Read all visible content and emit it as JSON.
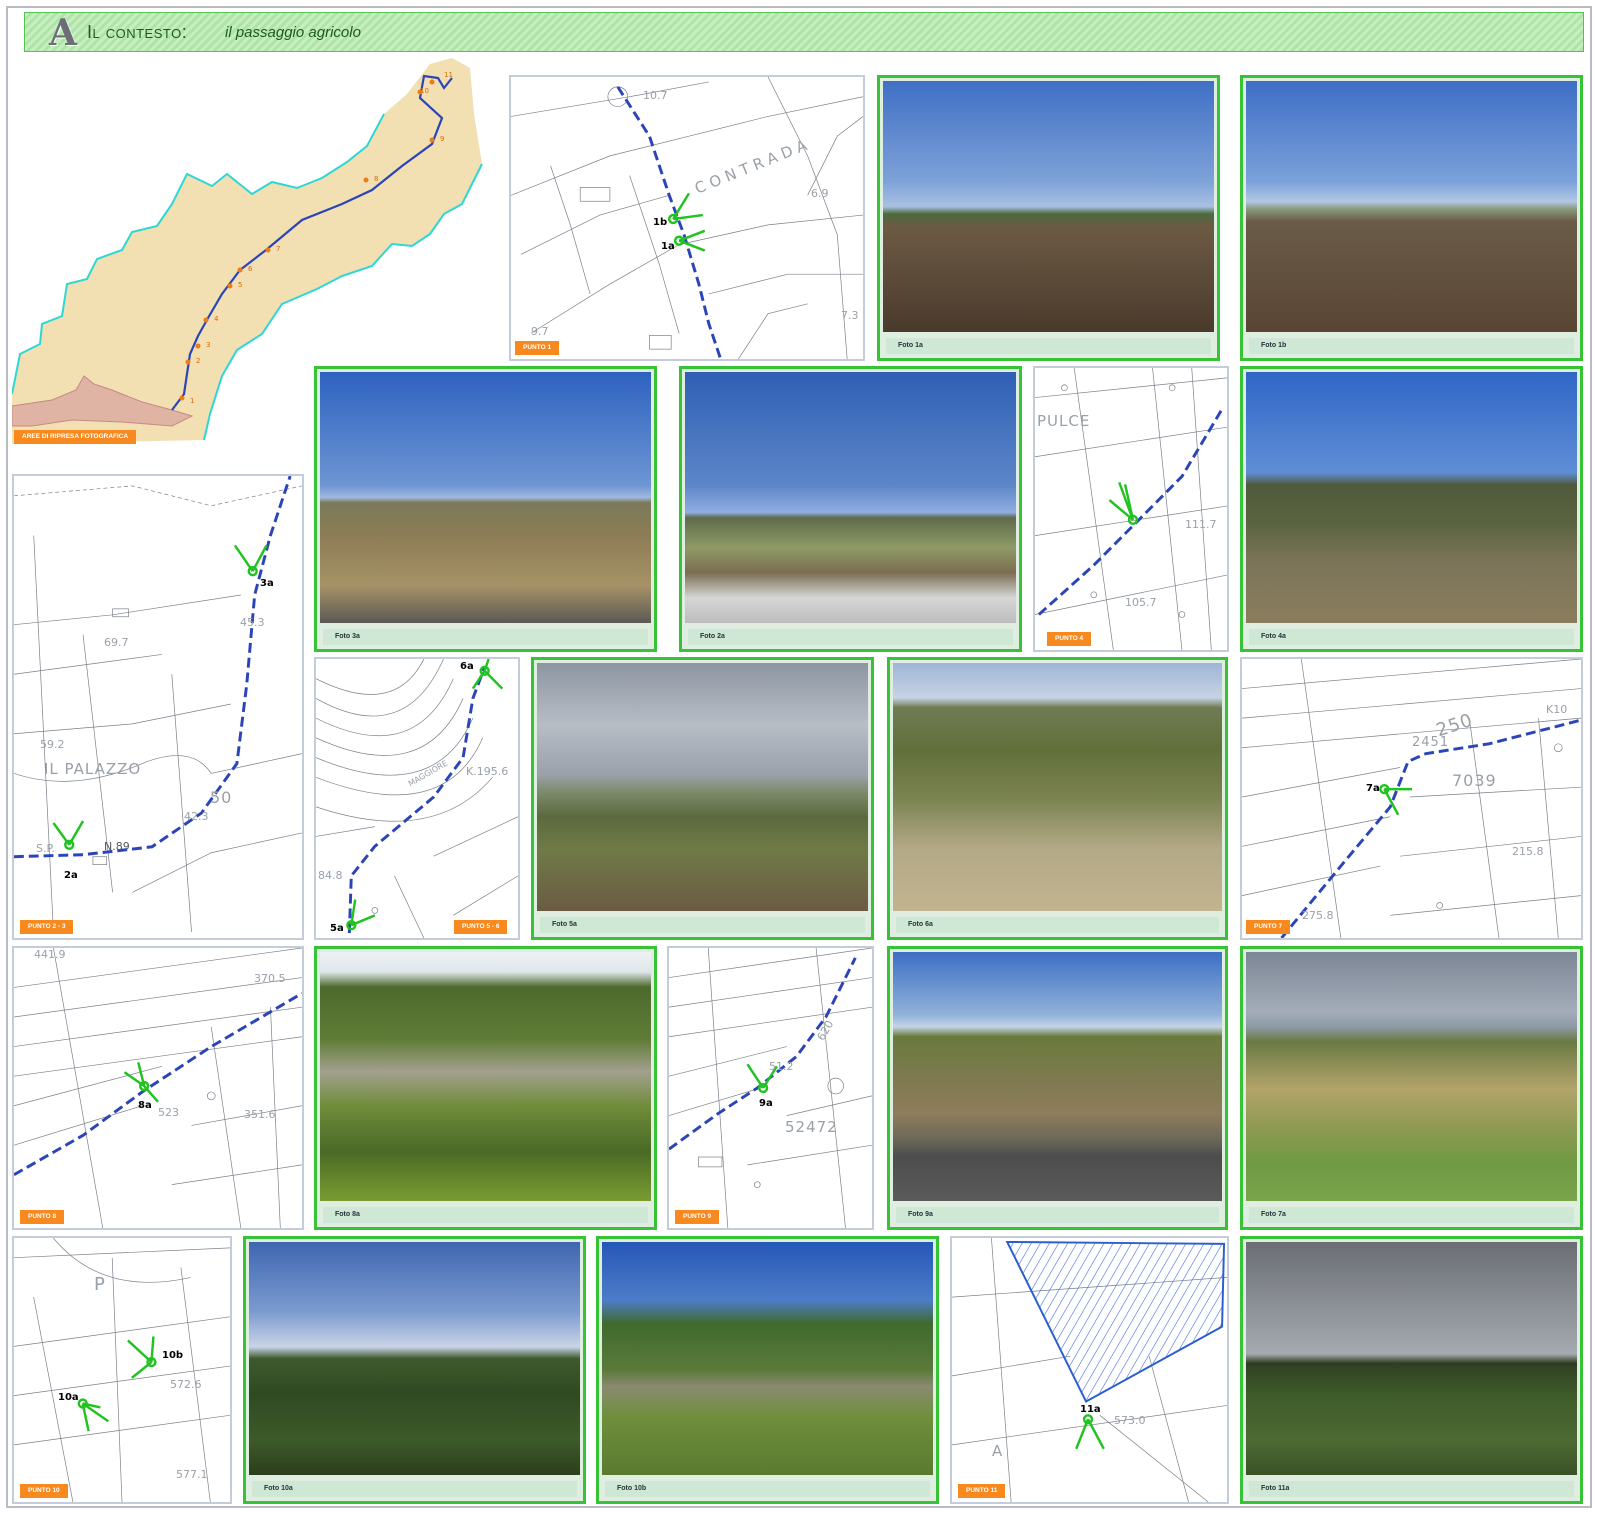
{
  "header": {
    "letter": "A",
    "title": "Il contesto:",
    "subtitle": "il passaggio agricolo"
  },
  "overview": {
    "caption": "AREE DI RIPRESA FOTOGRAFICA",
    "points": [
      "1",
      "2",
      "3",
      "4",
      "5",
      "6",
      "7",
      "8",
      "9",
      "10",
      "11"
    ]
  },
  "maps": {
    "p1": {
      "tag": "PUNTO 1",
      "labels": [
        "1b",
        "1a"
      ],
      "texts": [
        "CONTRADA",
        "10.7",
        "6.9",
        "7.3",
        "9.7"
      ]
    },
    "p23": {
      "tag": "PUNTO 2 - 3",
      "labels": [
        "3a",
        "2a"
      ],
      "texts": [
        "IL PALAZZO",
        "69.7",
        "45.3",
        "59.2",
        "50",
        "42.3",
        "N.89",
        "S.P."
      ]
    },
    "p4": {
      "tag": "PUNTO 4",
      "labels": [],
      "texts": [
        "PULCE",
        "111.7",
        "105.7"
      ]
    },
    "p56": {
      "tag": "PUNTO 5 - 6",
      "labels": [
        "6a",
        "5a"
      ],
      "texts": [
        "MAGGIORE",
        "K.195.6",
        "84.8"
      ]
    },
    "p7": {
      "tag": "PUNTO 7",
      "labels": [
        "7a"
      ],
      "texts": [
        "250",
        "K10",
        "2451",
        "7039",
        "215.8",
        "275.8"
      ]
    },
    "p8": {
      "tag": "PUNTO 8",
      "labels": [
        "8a"
      ],
      "texts": [
        "441.9",
        "370.5",
        "351.6",
        "523"
      ]
    },
    "p9": {
      "tag": "PUNTO 9",
      "labels": [
        "9a"
      ],
      "texts": [
        "51.2",
        "52472",
        "620"
      ]
    },
    "p10": {
      "tag": "PUNTO 10",
      "labels": [
        "10b",
        "10a"
      ],
      "texts": [
        "P",
        "572.6",
        "577.1"
      ]
    },
    "p11": {
      "tag": "PUNTO 11",
      "labels": [
        "11a"
      ],
      "texts": [
        "573.0",
        "A"
      ]
    }
  },
  "photos": {
    "f1a": "Foto 1a",
    "f1b": "Foto 1b",
    "f3a": "Foto 3a",
    "f2a": "Foto 2a",
    "f4a": "Foto 4a",
    "f5a": "Foto 5a",
    "f6a": "Foto 6a",
    "f8a": "Foto 8a",
    "f9a": "Foto 9a",
    "f7a": "Foto 7a",
    "f10a": "Foto 10a",
    "f10b": "Foto 10b",
    "f11a": "Foto 11a"
  },
  "colors": {
    "photo_border": "#36c336",
    "tag_orange": "#f7891f",
    "route_blue": "#2b45b8",
    "viewpoint_green": "#21c321",
    "land_beige": "#f2dfb2",
    "coast_cyan": "#2fd6d6",
    "sky_blue": "#3f70c8"
  }
}
